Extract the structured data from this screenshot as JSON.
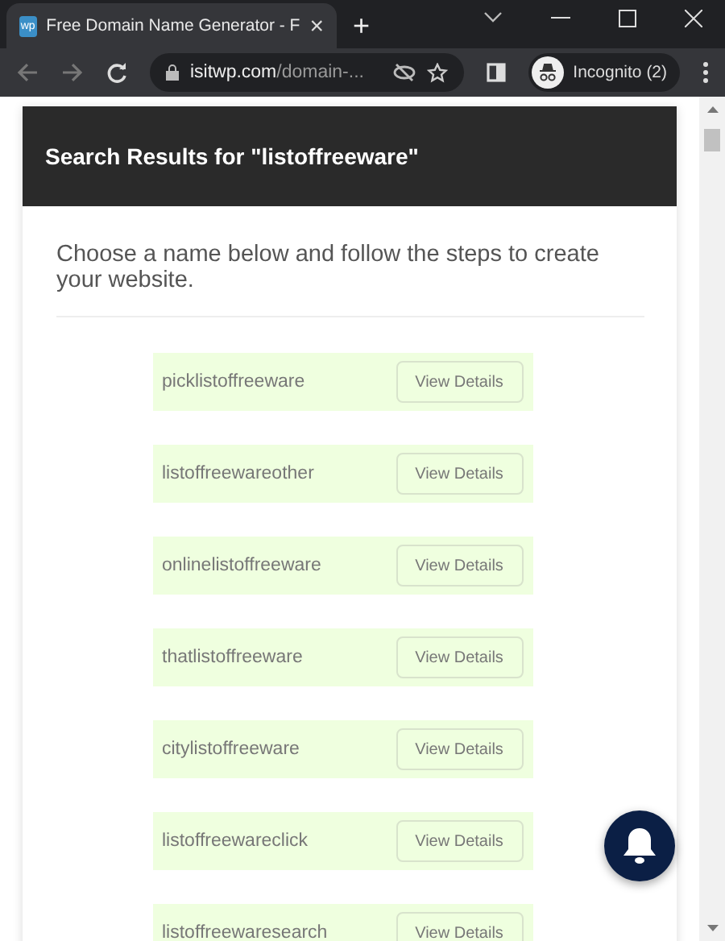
{
  "browser": {
    "tab": {
      "favicon": "wp",
      "title": "Free Domain Name Generator - F",
      "close": "×"
    },
    "new_tab": "+",
    "url_host": "isitwp.com",
    "url_path": "/domain-...",
    "profile": "Incognito (2)"
  },
  "card": {
    "title": "Search Results for \"listoffreeware\"",
    "intro": "Choose a name below and follow the steps to create your website."
  },
  "results": [
    {
      "name": "picklistoffreeware",
      "button": "View Details"
    },
    {
      "name": "listoffreewareother",
      "button": "View Details"
    },
    {
      "name": "onlinelistoffreeware",
      "button": "View Details"
    },
    {
      "name": "thatlistoffreeware",
      "button": "View Details"
    },
    {
      "name": "citylistoffreeware",
      "button": "View Details"
    },
    {
      "name": "listoffreewareclick",
      "button": "View Details"
    },
    {
      "name": "listoffreewaresearch",
      "button": "View Details"
    }
  ]
}
